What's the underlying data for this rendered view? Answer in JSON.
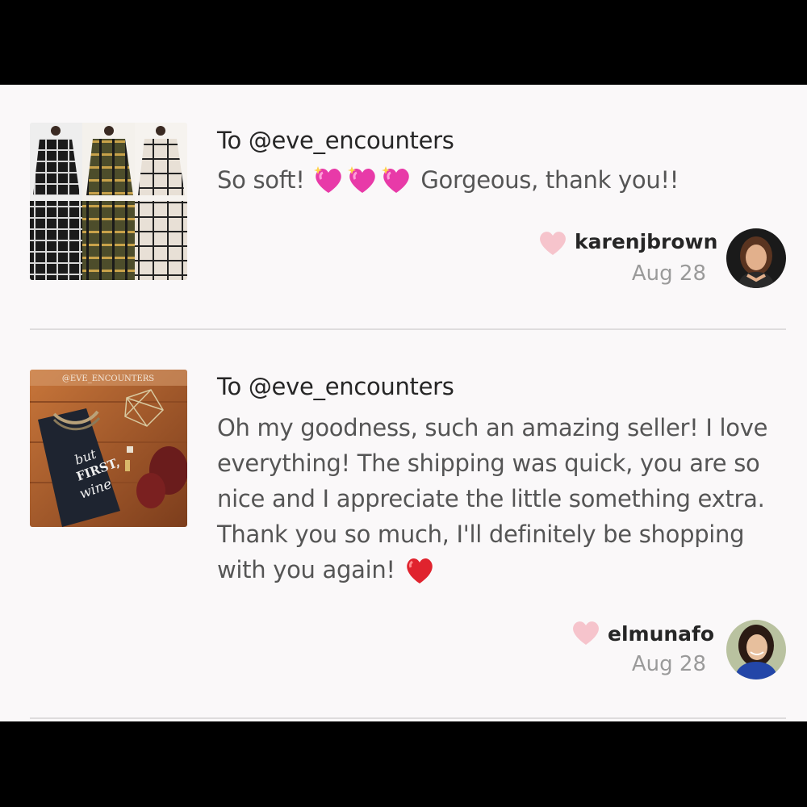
{
  "colors": {
    "panel_bg": "#faf8f9",
    "like_heart": "#f6c4cc",
    "divider": "#dedcdd",
    "text_primary": "#262626",
    "text_secondary": "#555555",
    "text_date": "#9a9a9a"
  },
  "reviews": [
    {
      "to": "To @eve_encounters",
      "message_before_emoji": "So soft!",
      "emojis": [
        "sparkling-heart",
        "sparkling-heart",
        "sparkling-heart"
      ],
      "message_after_emoji": "Gorgeous, thank you!!",
      "username": "karenjbrown",
      "date": "Aug 28",
      "thumbnail": "plaid-blanket-scarves-collage",
      "avatar": "woman-avatar"
    },
    {
      "to": "To @eve_encounters",
      "message": "Oh my goodness, such an amazing seller! I love everything! The shipping was quick, you are so nice and I appreciate the little something extra. Thank you so much, I'll definitely be shopping with you again!",
      "emojis": [
        "red-heart"
      ],
      "thumbnail_caption": "@EVE_ENCOUNTERS",
      "username": "elmunafo",
      "date": "Aug 28",
      "thumbnail": "but-first-wine-tee-flatlay",
      "avatar": "woman-avatar"
    }
  ]
}
